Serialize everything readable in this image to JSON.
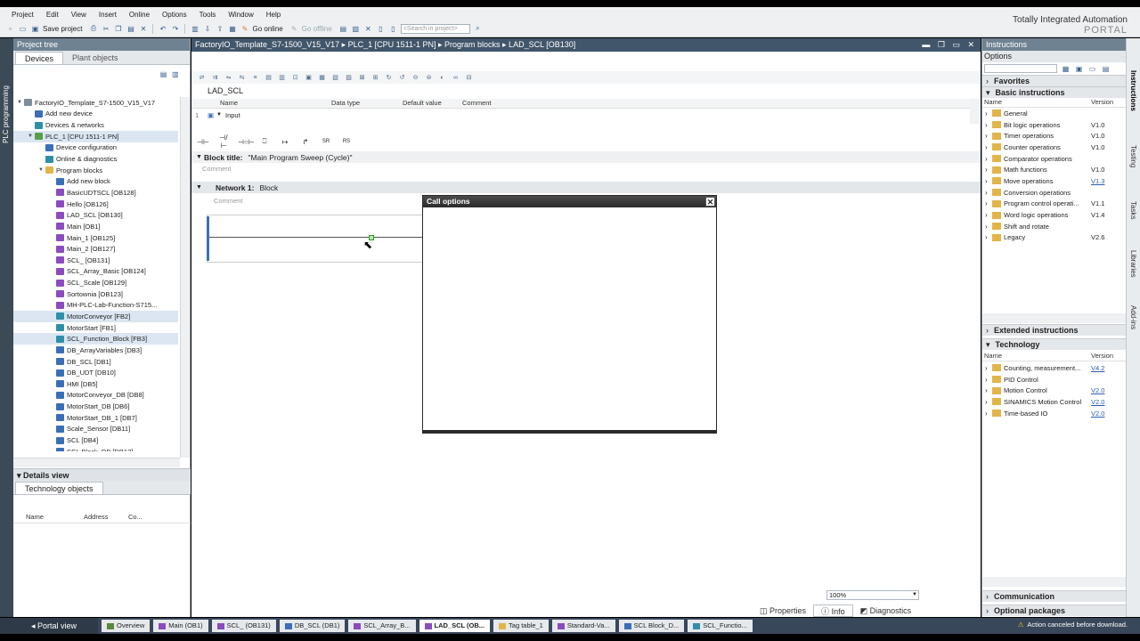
{
  "menu": [
    "Project",
    "Edit",
    "View",
    "Insert",
    "Online",
    "Options",
    "Tools",
    "Window",
    "Help"
  ],
  "toolbar": {
    "save_label": "Save project",
    "go_online": "Go online",
    "go_offline": "Go offline",
    "search_placeholder": "<Search in project>"
  },
  "brand": {
    "line1": "Totally Integrated Automation",
    "line2": "PORTAL"
  },
  "left_strip_label": "PLC programming",
  "project_tree": {
    "title": "Project tree",
    "tabs": [
      "Devices",
      "Plant objects"
    ],
    "items": [
      {
        "label": "FactoryIO_Template_S7-1500_V15_V17",
        "indent": 0,
        "tw": "▼",
        "icon": "gray"
      },
      {
        "label": "Add new device",
        "indent": 1,
        "tw": "",
        "icon": "blue"
      },
      {
        "label": "Devices & networks",
        "indent": 1,
        "tw": "",
        "icon": "teal"
      },
      {
        "label": "PLC_1 [CPU 1511-1 PN]",
        "indent": 1,
        "tw": "▼",
        "icon": "green",
        "selected": true
      },
      {
        "label": "Device configuration",
        "indent": 2,
        "tw": "",
        "icon": "blue"
      },
      {
        "label": "Online & diagnostics",
        "indent": 2,
        "tw": "",
        "icon": "teal"
      },
      {
        "label": "Program blocks",
        "indent": 2,
        "tw": "▼",
        "icon": "folder"
      },
      {
        "label": "Add new block",
        "indent": 3,
        "tw": "",
        "icon": "blue"
      },
      {
        "label": "BasicUDTSCL [OB128]",
        "indent": 3,
        "tw": "",
        "icon": "purple"
      },
      {
        "label": "Hello [OB126]",
        "indent": 3,
        "tw": "",
        "icon": "purple"
      },
      {
        "label": "LAD_SCL [OB130]",
        "indent": 3,
        "tw": "",
        "icon": "purple"
      },
      {
        "label": "Main [OB1]",
        "indent": 3,
        "tw": "",
        "icon": "purple"
      },
      {
        "label": "Main_1 [OB125]",
        "indent": 3,
        "tw": "",
        "icon": "purple"
      },
      {
        "label": "Main_2 [OB127]",
        "indent": 3,
        "tw": "",
        "icon": "purple"
      },
      {
        "label": "SCL_ [OB131]",
        "indent": 3,
        "tw": "",
        "icon": "purple"
      },
      {
        "label": "SCL_Array_Basic [OB124]",
        "indent": 3,
        "tw": "",
        "icon": "purple"
      },
      {
        "label": "SCL_Scale [OB129]",
        "indent": 3,
        "tw": "",
        "icon": "purple"
      },
      {
        "label": "Sortownia [OB123]",
        "indent": 3,
        "tw": "",
        "icon": "purple"
      },
      {
        "label": "MH-PLC-Lab-Function-S715...",
        "indent": 3,
        "tw": "",
        "icon": "purple"
      },
      {
        "label": "MotorConveyor [FB2]",
        "indent": 3,
        "tw": "",
        "icon": "teal",
        "selected": true
      },
      {
        "label": "MotorStart [FB1]",
        "indent": 3,
        "tw": "",
        "icon": "teal"
      },
      {
        "label": "SCL_Function_Block [FB3]",
        "indent": 3,
        "tw": "",
        "icon": "teal",
        "selected": true
      },
      {
        "label": "DB_ArrayVariables [DB3]",
        "indent": 3,
        "tw": "",
        "icon": "blue"
      },
      {
        "label": "DB_SCL [DB1]",
        "indent": 3,
        "tw": "",
        "icon": "blue"
      },
      {
        "label": "DB_UDT [DB10]",
        "indent": 3,
        "tw": "",
        "icon": "blue"
      },
      {
        "label": "HMI [DB5]",
        "indent": 3,
        "tw": "",
        "icon": "blue"
      },
      {
        "label": "MotorConveyor_DB [DB8]",
        "indent": 3,
        "tw": "",
        "icon": "blue"
      },
      {
        "label": "MotorStart_DB [DB6]",
        "indent": 3,
        "tw": "",
        "icon": "blue"
      },
      {
        "label": "MotorStart_DB_1 [DB7]",
        "indent": 3,
        "tw": "",
        "icon": "blue"
      },
      {
        "label": "Scale_Sensor [DB11]",
        "indent": 3,
        "tw": "",
        "icon": "blue"
      },
      {
        "label": "SCL [DB4]",
        "indent": 3,
        "tw": "",
        "icon": "blue"
      },
      {
        "label": "SCL Block_DB [DB12]",
        "indent": 3,
        "tw": "",
        "icon": "blue"
      }
    ],
    "details_view": "Details view",
    "details_tab": "Technology objects",
    "details_cols": [
      "Name",
      "Address",
      "Co..."
    ]
  },
  "editor": {
    "breadcrumb": "FactoryIO_Template_S7-1500_V15_V17  ▸  PLC_1 [CPU 1511-1 PN]  ▸  Program blocks  ▸  LAD_SCL [OB130]",
    "block_name": "LAD_SCL",
    "iface_cols": [
      "Name",
      "Data type",
      "Default value",
      "Comment"
    ],
    "iface_row_num": "1",
    "iface_row_name": "Input",
    "lad_icons": [
      "⊣⊢",
      "⊣/⊢",
      "⊣○⊢",
      "⎕",
      "↦",
      "↱",
      "SR",
      "RS"
    ],
    "block_title_label": "Block title:",
    "block_title_value": "\"Main Program Sweep (Cycle)\"",
    "comment": "Comment",
    "network_label": "Network 1:",
    "network_value": "Block",
    "zoom": "100%",
    "bottom_tabs": [
      "Properties",
      "Info",
      "Diagnostics"
    ]
  },
  "dialog": {
    "title": "Call options"
  },
  "instructions": {
    "title": "Instructions",
    "options": "Options",
    "favorites": "Favorites",
    "basic": "Basic instructions",
    "col_name": "Name",
    "col_version": "Version",
    "basic_items": [
      {
        "name": "General",
        "version": "",
        "link": false
      },
      {
        "name": "Bit logic operations",
        "version": "V1.0",
        "link": false
      },
      {
        "name": "Timer operations",
        "version": "V1.0",
        "link": false
      },
      {
        "name": "Counter operations",
        "version": "V1.0",
        "link": false
      },
      {
        "name": "Comparator operations",
        "version": "",
        "link": false
      },
      {
        "name": "Math functions",
        "version": "V1.0",
        "link": false
      },
      {
        "name": "Move operations",
        "version": "V1.3",
        "link": true
      },
      {
        "name": "Conversion operations",
        "version": "",
        "link": false
      },
      {
        "name": "Program control operati...",
        "version": "V1.1",
        "link": false
      },
      {
        "name": "Word logic operations",
        "version": "V1.4",
        "link": false
      },
      {
        "name": "Shift and rotate",
        "version": "",
        "link": false
      },
      {
        "name": "Legacy",
        "version": "V2.6",
        "link": false
      }
    ],
    "extended": "Extended instructions",
    "technology": "Technology",
    "tech_items": [
      {
        "name": "Counting, measurement...",
        "version": "V4.2",
        "link": true
      },
      {
        "name": "PID Control",
        "version": "",
        "link": false
      },
      {
        "name": "Motion Control",
        "version": "V2.0",
        "link": true
      },
      {
        "name": "SINAMICS Motion Control",
        "version": "V2.0",
        "link": true
      },
      {
        "name": "Time-based IO",
        "version": "V2.0",
        "link": true
      }
    ],
    "communication": "Communication",
    "optional": "Optional packages",
    "side_tabs": [
      "Instructions",
      "Testing",
      "Tasks",
      "Libraries",
      "Add-ins"
    ]
  },
  "taskbar": {
    "portal_view": "Portal view",
    "tasks": [
      "Overview",
      "Main (OB1)",
      "SCL_ (OB131)",
      "DB_SCL (DB1)",
      "SCL_Array_B...",
      "LAD_SCL (OB...",
      "Tag table_1",
      "Standard-Va...",
      "SCL Block_D...",
      "SCL_Functio..."
    ],
    "active_index": 5,
    "status": "Action canceled before download."
  }
}
